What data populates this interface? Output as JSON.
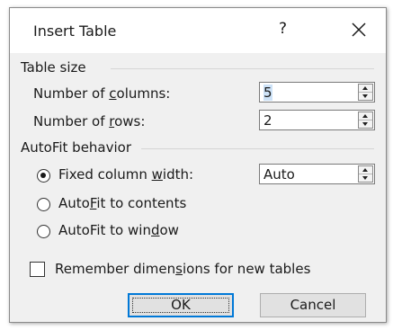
{
  "dialog": {
    "title": "Insert Table",
    "help_label": "?",
    "close_icon": "close-icon"
  },
  "table_size": {
    "group_label": "Table size",
    "columns": {
      "label_pre": "Number of ",
      "label_ul": "c",
      "label_post": "olumns:",
      "value": "5"
    },
    "rows": {
      "label_pre": "Number of ",
      "label_ul": "r",
      "label_post": "ows:",
      "value": "2"
    }
  },
  "autofit": {
    "group_label": "AutoFit behavior",
    "fixed": {
      "label_pre": "Fixed column ",
      "label_ul": "w",
      "label_post": "idth:",
      "selected": true,
      "value": "Auto"
    },
    "contents": {
      "label_pre": "Auto",
      "label_ul": "F",
      "label_post": "it to contents",
      "selected": false
    },
    "window": {
      "label_pre": "AutoFit to win",
      "label_ul": "d",
      "label_post": "ow",
      "selected": false
    }
  },
  "remember": {
    "label_pre": "Remember dimen",
    "label_ul": "s",
    "label_post": "ions for new tables",
    "checked": false
  },
  "buttons": {
    "ok": "OK",
    "cancel": "Cancel"
  },
  "colors": {
    "dialog_bg": "#f0f0f0",
    "title_bg": "#ffffff",
    "default_button_border": "#0078d7"
  }
}
